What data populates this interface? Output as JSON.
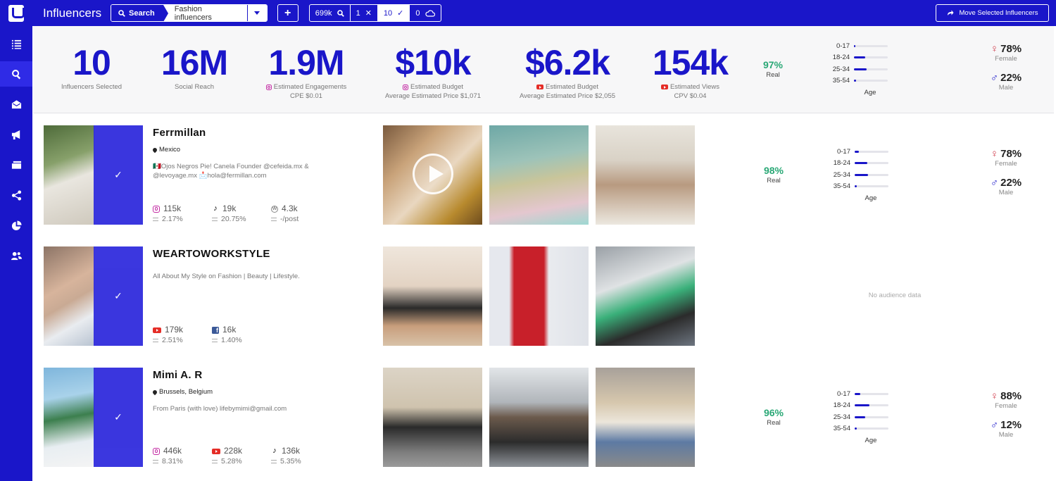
{
  "app": {
    "title": "Influencers"
  },
  "search": {
    "button_label": "Search",
    "query": "Fashion influencers"
  },
  "add_label": "+",
  "counters": [
    {
      "value": "699k",
      "icon": "search-icon"
    },
    {
      "value": "1",
      "icon": "close-icon"
    },
    {
      "value": "10",
      "icon": "check-icon"
    },
    {
      "value": "0",
      "icon": "cloud-icon"
    }
  ],
  "move_button": "Move Selected Influencers",
  "sidebar": {
    "items": [
      {
        "icon": "list-icon",
        "active": false
      },
      {
        "icon": "search-icon",
        "active": true
      },
      {
        "icon": "inbox-icon",
        "active": false
      },
      {
        "icon": "megaphone-icon",
        "active": false
      },
      {
        "icon": "cards-icon",
        "active": false
      },
      {
        "icon": "share-icon",
        "active": false
      },
      {
        "icon": "pie-chart-icon",
        "active": false
      },
      {
        "icon": "users-icon",
        "active": false
      }
    ]
  },
  "summary": {
    "influencers": {
      "value": "10",
      "label": "Influencers Selected"
    },
    "reach": {
      "value": "16M",
      "label": "Social Reach"
    },
    "engagements": {
      "value": "1.9M",
      "label": "Estimated Engagements",
      "sub": "CPE $0.01"
    },
    "budget_ig": {
      "value": "$10k",
      "label": "Estimated Budget",
      "sub": "Average Estimated Price $1,071"
    },
    "budget_yt": {
      "value": "$6.2k",
      "label": "Estimated Budget",
      "sub": "Average Estimated Price $2,055"
    },
    "views": {
      "value": "154k",
      "label": "Estimated Views",
      "sub": "CPV $0.04"
    },
    "real": {
      "pct": "97%",
      "label": "Real"
    },
    "age": {
      "title": "Age",
      "groups": [
        {
          "label": "0-17",
          "fill": 0.04
        },
        {
          "label": "18-24",
          "fill": 0.34
        },
        {
          "label": "25-34",
          "fill": 0.38
        },
        {
          "label": "35-54",
          "fill": 0.06
        }
      ]
    },
    "gender": {
      "female_pct": "78%",
      "female_label": "Female",
      "male_pct": "22%",
      "male_label": "Male"
    }
  },
  "influencers": [
    {
      "name": "Ferrmillan",
      "location": "Mexico",
      "bio": "🇲🇽Ojos Negros Pie! Canela Founder @cefeida.mx & @levoyage.mx 📩hola@fermillan.com",
      "metrics": [
        {
          "platform": "instagram",
          "followers": "115k",
          "rate": "2.17%"
        },
        {
          "platform": "tiktok",
          "followers": "19k",
          "rate": "20.75%"
        },
        {
          "platform": "wordpress",
          "followers": "4.3k",
          "rate": "-/post"
        }
      ],
      "real": {
        "pct": "98%",
        "label": "Real"
      },
      "age": {
        "title": "Age",
        "groups": [
          {
            "label": "0-17",
            "fill": 0.12
          },
          {
            "label": "18-24",
            "fill": 0.38
          },
          {
            "label": "25-34",
            "fill": 0.4
          },
          {
            "label": "35-54",
            "fill": 0.06
          }
        ]
      },
      "gender": {
        "female_pct": "78%",
        "female_label": "Female",
        "male_pct": "22%",
        "male_label": "Male"
      }
    },
    {
      "name": "WEARTOWORKSTYLE",
      "location": "",
      "bio": "All About My Style on Fashion | Beauty | Lifestyle.",
      "metrics": [
        {
          "platform": "youtube",
          "followers": "179k",
          "rate": "2.51%"
        },
        {
          "platform": "facebook",
          "followers": "16k",
          "rate": "1.40%"
        }
      ],
      "no_audience": "No audience data"
    },
    {
      "name": "Mimi A. R",
      "location": "Brussels, Belgium",
      "bio": "From Paris (with love) lifebymimi@gmail.com",
      "metrics": [
        {
          "platform": "instagram",
          "followers": "446k",
          "rate": "8.31%"
        },
        {
          "platform": "youtube",
          "followers": "228k",
          "rate": "5.28%"
        },
        {
          "platform": "tiktok",
          "followers": "136k",
          "rate": "5.35%"
        }
      ],
      "real": {
        "pct": "96%",
        "label": "Real"
      },
      "age": {
        "title": "Age",
        "groups": [
          {
            "label": "0-17",
            "fill": 0.16
          },
          {
            "label": "18-24",
            "fill": 0.44
          },
          {
            "label": "25-34",
            "fill": 0.32
          },
          {
            "label": "35-54",
            "fill": 0.06
          }
        ]
      },
      "gender": {
        "female_pct": "88%",
        "female_label": "Female",
        "male_pct": "12%",
        "male_label": "Male"
      }
    }
  ],
  "colors": {
    "brand": "#1a16c9",
    "real": "#2aa876",
    "female": "#d03a4a"
  }
}
